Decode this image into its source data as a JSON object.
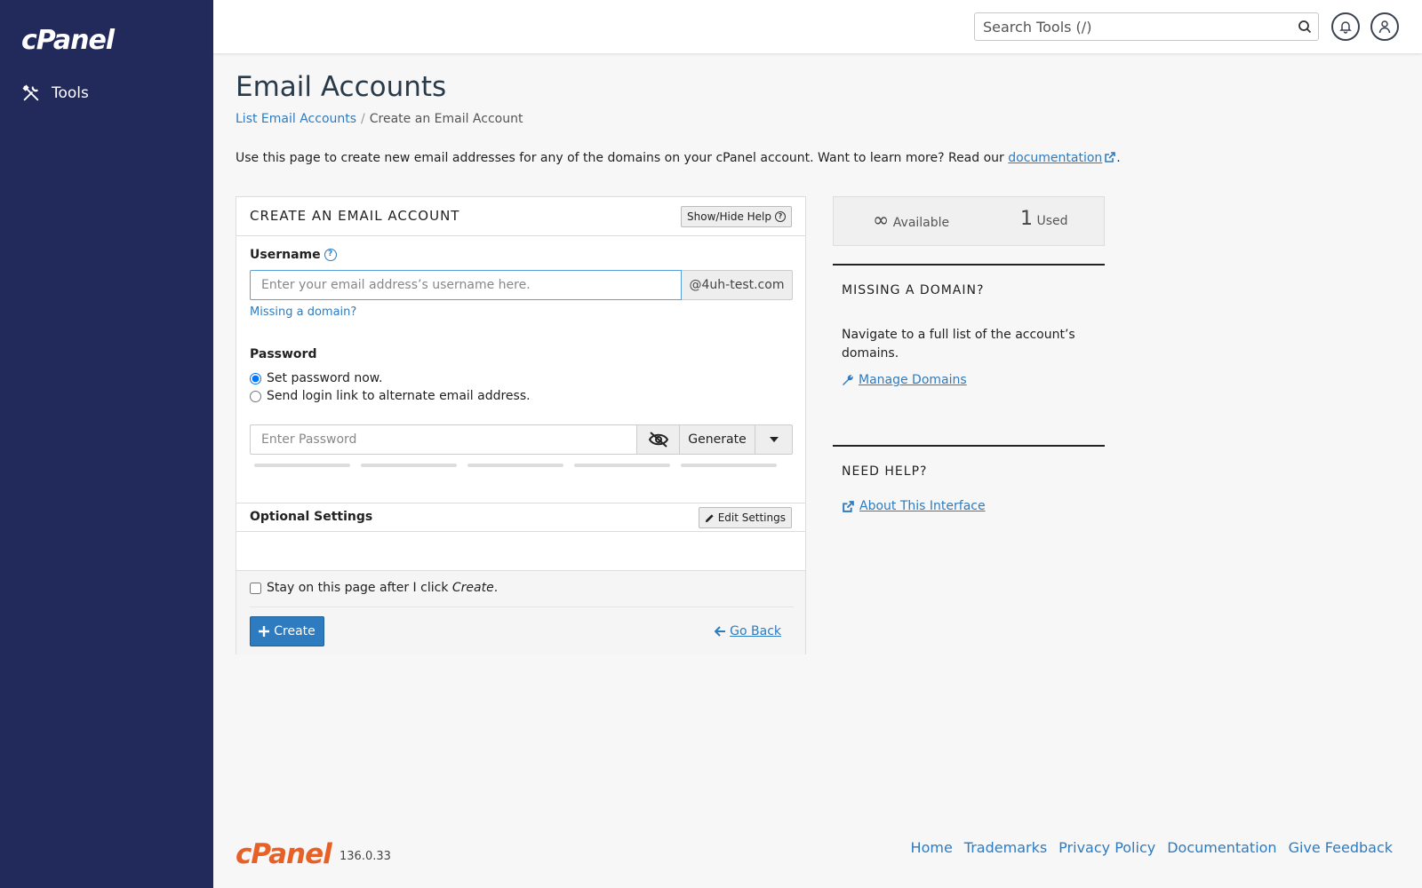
{
  "brand": {
    "logo_text": "cPanel",
    "version": "136.0.33"
  },
  "sidebar": {
    "items": [
      {
        "label": "Tools",
        "icon": "tools-icon"
      }
    ]
  },
  "topbar": {
    "search_placeholder": "Search Tools (/)"
  },
  "page": {
    "title": "Email Accounts",
    "breadcrumb": {
      "link": "List Email Accounts",
      "separator": "/",
      "current": "Create an Email Account"
    },
    "intro_text": "Use this page to create new email addresses for any of the domains on your cPanel account. Want to learn more? Read our ",
    "intro_link": "documentation",
    "intro_end": "."
  },
  "form": {
    "title": "CREATE AN EMAIL ACCOUNT",
    "help_button": "Show/Hide Help",
    "username_label": "Username",
    "username_placeholder": "Enter your email address’s username here.",
    "domain": "@4uh-test.com",
    "missing_domain_link": "Missing a domain?",
    "password_label": "Password",
    "radio_set_now": "Set password now.",
    "radio_send_link": "Send login link to alternate email address.",
    "password_placeholder": "Enter Password",
    "generate_button": "Generate",
    "optional_settings": "Optional Settings",
    "edit_settings": "Edit Settings",
    "stay_text": "Stay on this page after I click ",
    "stay_italic": "Create",
    "stay_end": ".",
    "create_button": "Create",
    "go_back": "Go Back"
  },
  "usage": {
    "available_value": "∞",
    "available_label": "Available",
    "used_value": "1",
    "used_label": "Used"
  },
  "missing_domain": {
    "title": "MISSING A DOMAIN?",
    "text": "Navigate to a full list of the account’s domains.",
    "link": "Manage Domains"
  },
  "need_help": {
    "title": "NEED HELP?",
    "link": "About This Interface"
  },
  "footer": {
    "links": [
      "Home",
      "Trademarks",
      "Privacy Policy",
      "Documentation",
      "Give Feedback"
    ]
  },
  "colors": {
    "sidebar": "#222a5b",
    "accent": "#2e7bc0",
    "logo_orange": "#e76126"
  }
}
